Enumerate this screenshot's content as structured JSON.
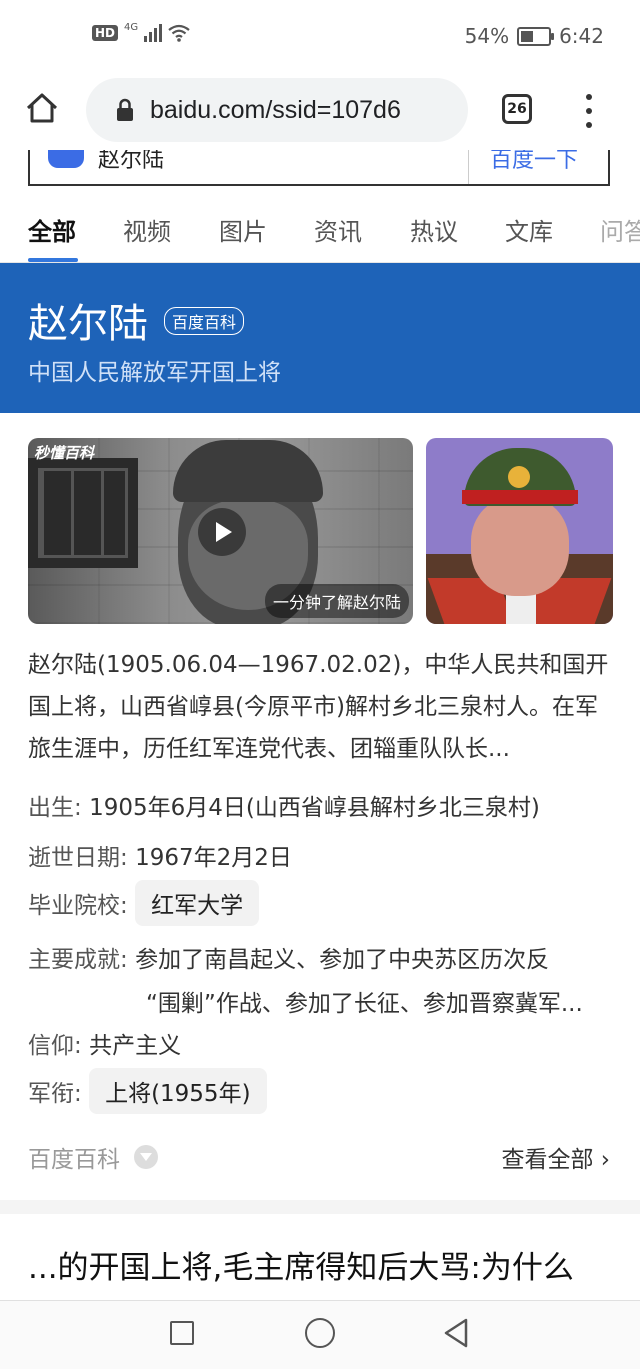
{
  "status_bar": {
    "network": "4G",
    "battery": "54%",
    "battery_level": 0.54,
    "time": "6:42"
  },
  "browser": {
    "url": "baidu.com/ssid=107d6",
    "tab_count": "26"
  },
  "search": {
    "query": "赵尔陆",
    "button": "百度一下"
  },
  "tabs": [
    "全部",
    "视频",
    "图片",
    "资讯",
    "热议",
    "文库",
    "问答"
  ],
  "card": {
    "name": "赵尔陆",
    "badge": "百度百科",
    "subtitle": "中国人民解放军开国上将",
    "video_brand": "秒懂百科",
    "video_caption": "一分钟了解赵尔陆",
    "description": "赵尔陆(1905.06.04—1967.02.02)，中华人民共和国开国上将，山西省崞县(今原平市)解村乡北三泉村人。在军旅生涯中，历任红军连党代表、团辎重队队长...",
    "info": {
      "birth_key": "出生:",
      "birth_val": "1905年6月4日(山西省崞县解村乡北三泉村)",
      "death_key": "逝世日期:",
      "death_val": "1967年2月2日",
      "school_key": "毕业院校:",
      "school_val": "红军大学",
      "achieve_key": "主要成就:",
      "achieve_val1": "参加了南昌起义、参加了中央苏区历次反",
      "achieve_val2": "“围剿”作战、参加了长征、参加晋察冀军...",
      "belief_key": "信仰:",
      "belief_val": "共产主义",
      "rank_key": "军衔:",
      "rank_val": "上将(1955年)"
    },
    "source": "百度百科",
    "view_all": "查看全部"
  },
  "next_result_title": "...的开国上将,毛主席得知后大骂:为什么"
}
